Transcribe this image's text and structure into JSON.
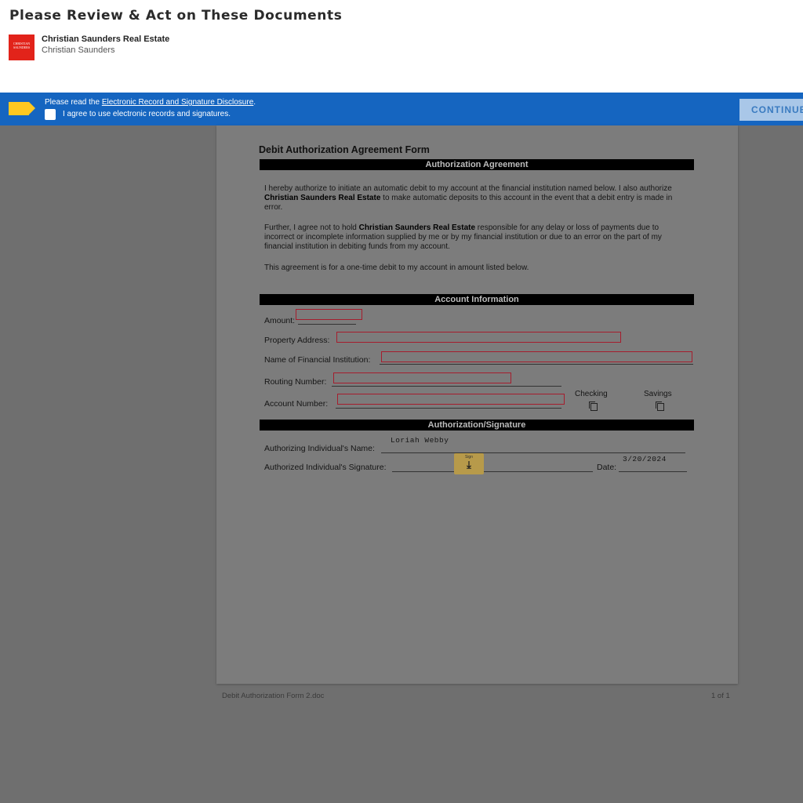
{
  "header": {
    "title": "Please Review & Act on These Documents",
    "company": "Christian Saunders Real Estate",
    "sender": "Christian Saunders",
    "logo_text": "CHRISTIAN SAUNDERS"
  },
  "banner": {
    "read_prefix": "Please read the ",
    "disclosure_link": "Electronic Record and Signature Disclosure",
    "read_suffix": ".",
    "consent_label": "I agree to use electronic records and signatures.",
    "consent_checked": false,
    "continue_label": "CONTINUE"
  },
  "document": {
    "title": "Debit Authorization Agreement Form",
    "section_agreement": "Authorization Agreement",
    "p1_a": "I hereby authorize to initiate an automatic debit to my account at the financial institution named below. I also authorize ",
    "p1_company": "Christian Saunders Real Estate",
    "p1_b": " to make automatic deposits to this account in the event that a debit entry is made in error.",
    "p2_a": "Further, I agree not to hold ",
    "p2_company": "Christian Saunders Real Estate",
    "p2_b": " responsible for any delay or loss of payments due to incorrect or incomplete information supplied by me or by my financial institution or due to an error on the part of my financial institution in debiting funds from my account.",
    "p3": "This agreement is for a one-time debit to my account in amount listed below.",
    "section_account": "Account Information",
    "amount_label": "Amount:",
    "property_label": "Property Address:",
    "institution_label": "Name of Financial Institution:",
    "routing_label": "Routing Number:",
    "account_label": "Account Number:",
    "checking_label": "Checking",
    "savings_label": "Savings",
    "section_signature": "Authorization/Signature",
    "authorizing_name_label": "Authorizing Individual's Name:",
    "authorizing_name_value": "Loriah Webby",
    "signature_label": "Authorized Individual's Signature:",
    "sign_tab_label": "Sign",
    "sign_tab_icon": "download-arrow-icon",
    "date_label": "Date:",
    "date_value": "3/20/2024"
  },
  "footer": {
    "filename": "Debit Authorization Form 2.doc",
    "page_count": "1 of 1"
  },
  "colors": {
    "banner": "#1565c0",
    "tag": "#ffc820",
    "field_border": "#a51d2d",
    "logo": "#e2231a"
  }
}
